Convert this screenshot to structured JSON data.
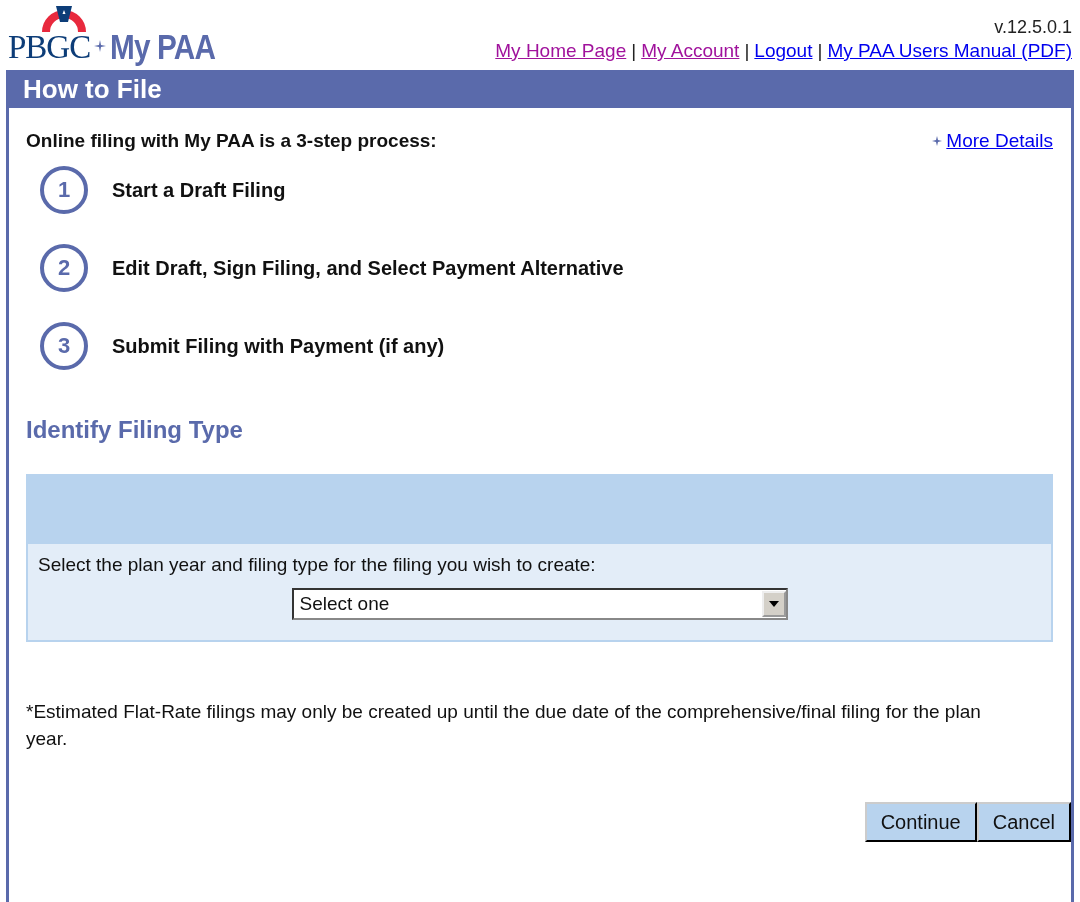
{
  "logo": {
    "org": "PBGC",
    "product": "My PAA"
  },
  "version": "v.12.5.0.1",
  "nav_links": [
    {
      "label": "My Home Page",
      "visited": true
    },
    {
      "label": "My Account",
      "visited": true
    },
    {
      "label": "Logout",
      "visited": false
    },
    {
      "label": "My PAA Users Manual (PDF)",
      "visited": false
    }
  ],
  "nav_separator": "|",
  "page_title": "How to File",
  "intro": "Online filing with My PAA is a 3-step process:",
  "more_details_link": "More Details",
  "steps": [
    {
      "number": "1",
      "label": "Start a Draft Filing"
    },
    {
      "number": "2",
      "label": "Edit Draft, Sign Filing, and Select Payment Alternative"
    },
    {
      "number": "3",
      "label": "Submit Filing with Payment (if any)"
    }
  ],
  "section_title": "Identify Filing Type",
  "filing_form": {
    "prompt": "Select the plan year and filing type for the filing you wish to create:",
    "select_value": "Select one"
  },
  "note": "*Estimated Flat-Rate filings may only be created up until the due date of the comprehensive/final filing for the plan year.",
  "buttons": [
    "Continue",
    "Cancel"
  ]
}
